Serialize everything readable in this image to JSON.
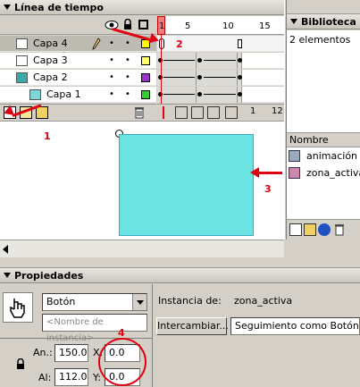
{
  "timeline": {
    "title": "Línea de tiempo",
    "frame_numbers": [
      "1",
      "5",
      "10",
      "15"
    ],
    "layers": [
      {
        "name": "Capa 4",
        "color": "#ffff00",
        "selected": true
      },
      {
        "name": "Capa 3",
        "color": "#ffff66"
      },
      {
        "name": "Capa 2",
        "color": "#9933cc"
      },
      {
        "name": "Capa 1",
        "color": "#33cc33"
      }
    ],
    "footer": {
      "current_frame": "1",
      "fps": "12"
    }
  },
  "library": {
    "title": "Biblioteca",
    "count": "2 elementos",
    "column_header": "Nombre",
    "items": [
      "animación",
      "zona_activa"
    ]
  },
  "annotations": [
    "1",
    "2",
    "3",
    "4"
  ],
  "properties": {
    "title": "Propiedades",
    "symbol_type": "Botón",
    "instance_placeholder": "<Nombre de instancia>",
    "instance_of_label": "Instancia de:",
    "instance_of_value": "zona_activa",
    "swap_button": "Intercambiar...",
    "tracking": "Seguimiento como Botón",
    "width_label": "An.:",
    "width_value": "150.0",
    "height_label": "Al:",
    "height_value": "112.0",
    "x_label": "X:",
    "x_value": "0.0",
    "y_label": "Y:",
    "y_value": "0.0"
  },
  "colors": {
    "stage_rect": "#6be3e3",
    "annotation_red": "#e00010",
    "timeline_selected": "#bdbab2"
  }
}
